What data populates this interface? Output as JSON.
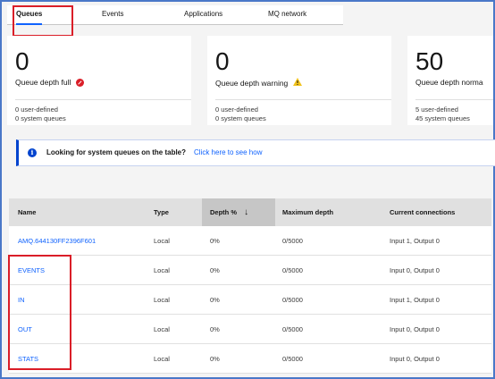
{
  "tabs": [
    {
      "label": "Queues",
      "active": true
    },
    {
      "label": "Events",
      "active": false
    },
    {
      "label": "Applications",
      "active": false
    },
    {
      "label": "MQ network",
      "active": false
    }
  ],
  "cards": [
    {
      "value": "0",
      "label": "Queue depth full",
      "status_icon": "error-icon",
      "user_defined": "0  user-defined",
      "system_queues": "0  system queues"
    },
    {
      "value": "0",
      "label": "Queue depth warning",
      "status_icon": "warning-icon",
      "user_defined": "0  user-defined",
      "system_queues": "0  system queues"
    },
    {
      "value": "50",
      "label": "Queue depth norma",
      "status_icon": "",
      "user_defined": "5  user-defined",
      "system_queues": "45  system queues"
    }
  ],
  "banner": {
    "message": "Looking for system queues on the table?",
    "link": "Click here to see how"
  },
  "table": {
    "headers": {
      "name": "Name",
      "type": "Type",
      "depth": "Depth %",
      "sort_glyph": "↓",
      "max_depth": "Maximum depth",
      "connections": "Current connections"
    },
    "rows": [
      {
        "name": "AMQ.644130FF2396F601",
        "type": "Local",
        "depth": "0%",
        "max_depth": "0/5000",
        "connections": "Input 1, Output 0"
      },
      {
        "name": "EVENTS",
        "type": "Local",
        "depth": "0%",
        "max_depth": "0/5000",
        "connections": "Input 0, Output 0"
      },
      {
        "name": "IN",
        "type": "Local",
        "depth": "0%",
        "max_depth": "0/5000",
        "connections": "Input 1, Output 0"
      },
      {
        "name": "OUT",
        "type": "Local",
        "depth": "0%",
        "max_depth": "0/5000",
        "connections": "Input 0, Output 0"
      },
      {
        "name": "STATS",
        "type": "Local",
        "depth": "0%",
        "max_depth": "0/5000",
        "connections": "Input 0, Output 0"
      }
    ]
  },
  "colors": {
    "accent": "#0f62fe",
    "highlight": "#da1e28",
    "frame": "#4a78c8"
  }
}
